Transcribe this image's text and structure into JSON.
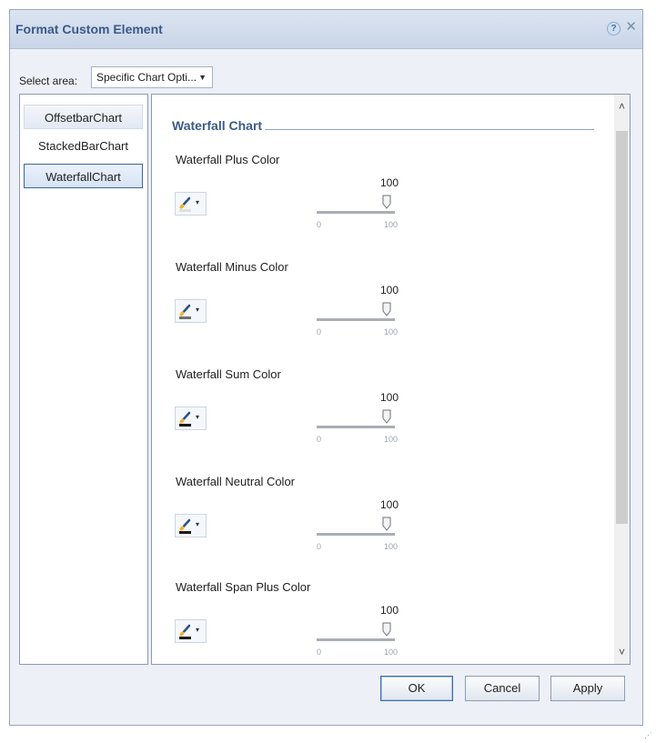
{
  "dialog": {
    "title": "Format Custom Element",
    "help_glyph": "?",
    "close_glyph": "✕"
  },
  "select_area": {
    "label": "Select area:",
    "value": "Specific Chart Opti...",
    "arrow": "▼"
  },
  "left_list": {
    "items": [
      {
        "label": "OffsetbarChart"
      },
      {
        "label": "StackedBarChart"
      },
      {
        "label": "WaterfallChart"
      }
    ],
    "selected": "WaterfallChart"
  },
  "right_panel": {
    "section_title": "Waterfall Chart",
    "groups": [
      {
        "label": "Waterfall Plus Color",
        "swatch_color": "#e0e0e0",
        "slider_value": "100",
        "min": "0",
        "max": "100"
      },
      {
        "label": "Waterfall Minus Color",
        "swatch_color": "#707070",
        "slider_value": "100",
        "min": "0",
        "max": "100"
      },
      {
        "label": "Waterfall Sum Color",
        "swatch_color": "#1a1a1a",
        "slider_value": "100",
        "min": "0",
        "max": "100"
      },
      {
        "label": "Waterfall Neutral Color",
        "swatch_color": "#1a1a1a",
        "slider_value": "100",
        "min": "0",
        "max": "100"
      },
      {
        "label": "Waterfall Span Plus Color",
        "swatch_color": "#1a1a1a",
        "slider_value": "100",
        "min": "0",
        "max": "100"
      }
    ],
    "caret": "▾",
    "scroll_up": "˄",
    "scroll_down": "˅"
  },
  "buttons": {
    "ok": "OK",
    "cancel": "Cancel",
    "apply": "Apply"
  },
  "colors": {
    "accent_title": "#3a5a8a",
    "selection_border": "#3c63a0"
  }
}
